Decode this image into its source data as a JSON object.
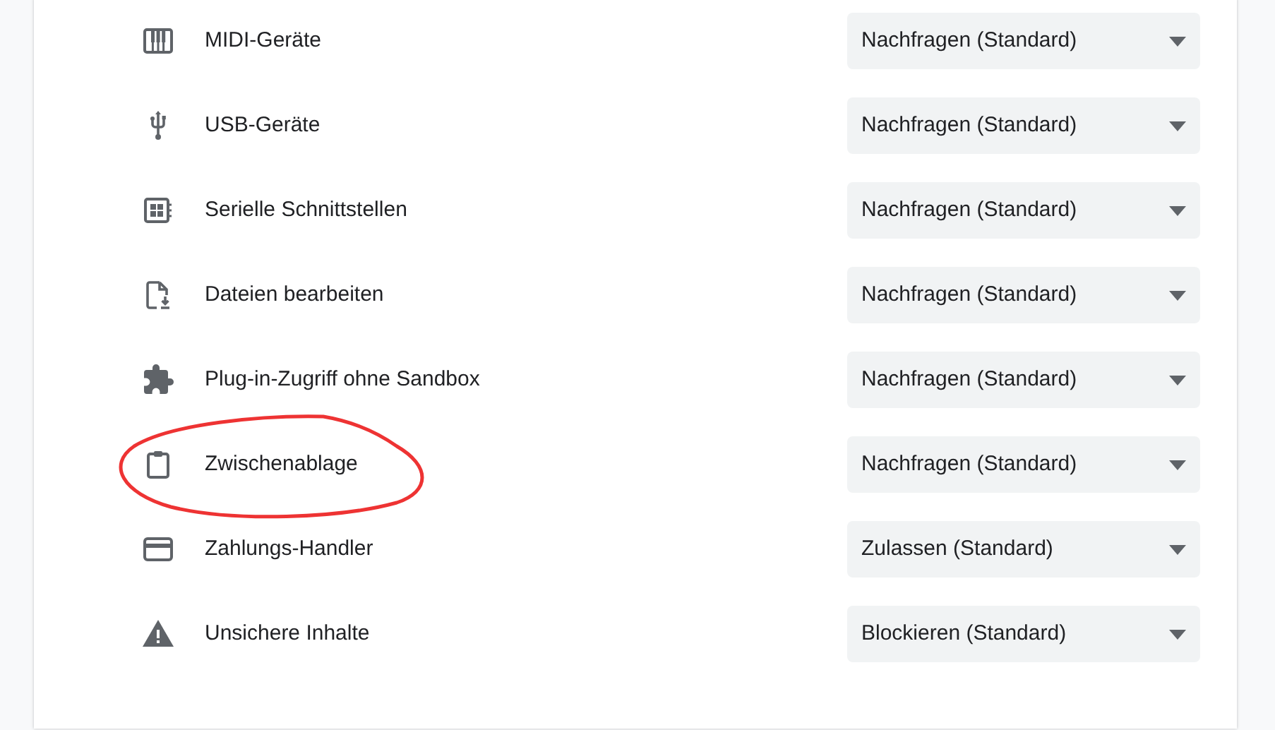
{
  "rows": [
    {
      "kind": "piano",
      "label": "MIDI-Geräte",
      "value": "Nachfragen (Standard)",
      "highlighted": false
    },
    {
      "kind": "usb",
      "label": "USB-Geräte",
      "value": "Nachfragen (Standard)",
      "highlighted": false
    },
    {
      "kind": "chip",
      "label": "Serielle Schnittstellen",
      "value": "Nachfragen (Standard)",
      "highlighted": false
    },
    {
      "kind": "file",
      "label": "Dateien bearbeiten",
      "value": "Nachfragen (Standard)",
      "highlighted": false
    },
    {
      "kind": "puzzle",
      "label": "Plug-in-Zugriff ohne Sandbox",
      "value": "Nachfragen (Standard)",
      "highlighted": false
    },
    {
      "kind": "clipboard",
      "label": "Zwischenablage",
      "value": "Nachfragen (Standard)",
      "highlighted": true
    },
    {
      "kind": "card",
      "label": "Zahlungs-Handler",
      "value": "Zulassen (Standard)",
      "highlighted": false
    },
    {
      "kind": "warning",
      "label": "Unsichere Inhalte",
      "value": "Blockieren (Standard)",
      "highlighted": false
    }
  ]
}
